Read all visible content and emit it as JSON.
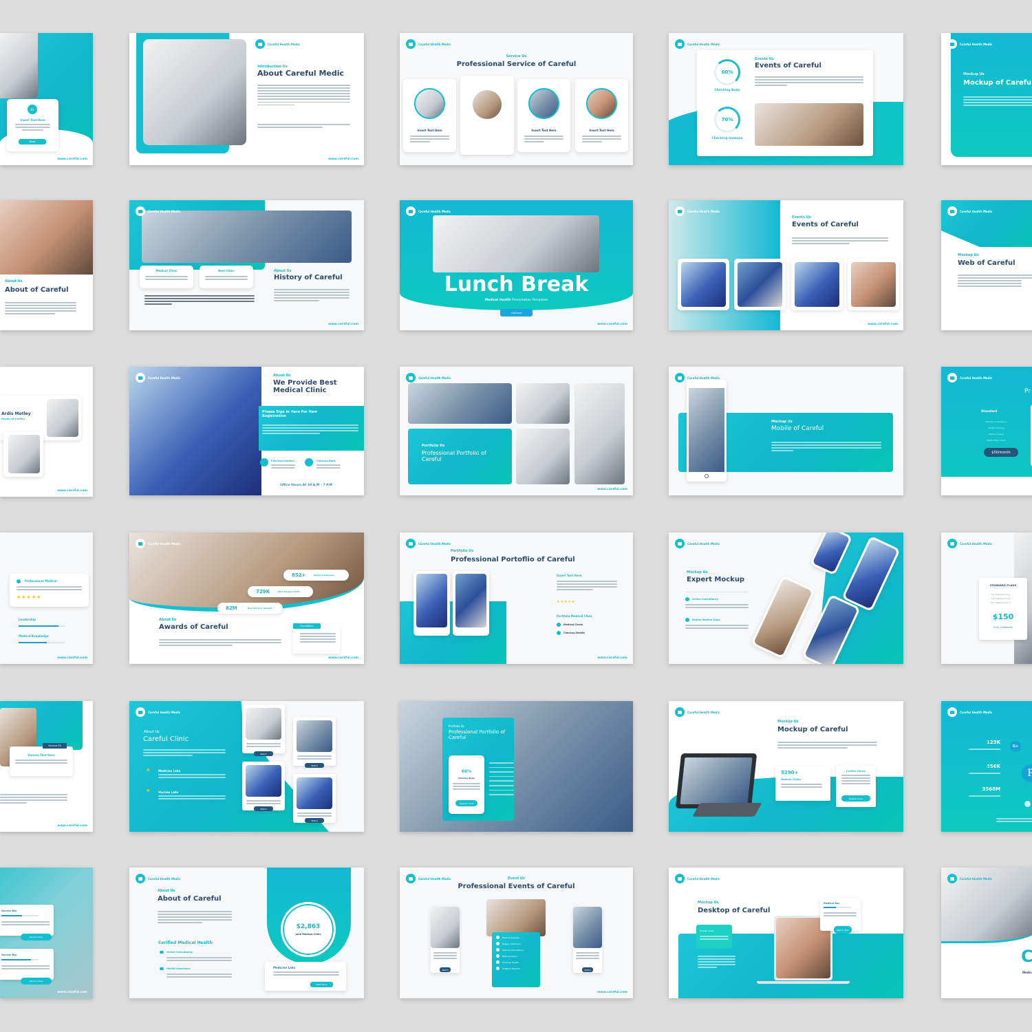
{
  "brand": {
    "logo_text": "Careful Health Medic",
    "url": "www.careful.com",
    "accent": "#14BFCF",
    "heading": "#2C4A6B",
    "background": "#DCDCDC"
  },
  "slides": {
    "r1c0": {
      "card_title": "Insert Text Here",
      "badge": "01",
      "button": "Read"
    },
    "r1c1": {
      "kicker": "Introduction Us",
      "title": "About Careful Medic"
    },
    "r1c2": {
      "kicker": "Service Us",
      "title": "Professional Service of Careful",
      "cards": [
        {
          "label": "Insert Text Here"
        },
        {
          "label": "Insert Text Here"
        },
        {
          "label": "Insert Text Here"
        },
        {
          "label": "Insert Text Here"
        }
      ]
    },
    "r1c3": {
      "kicker": "Events Us",
      "title": "Events of Careful",
      "gauges": [
        {
          "value": "60%",
          "label": "Checking Body"
        },
        {
          "value": "70%",
          "label": "Checking Immune"
        }
      ]
    },
    "r1c4": {
      "kicker": "Mockup Us",
      "title": "Mockup of Careful"
    },
    "r2c0": {
      "kicker": "About Us",
      "title": "About of Careful"
    },
    "r2c1": {
      "kicker": "About Us",
      "title": "History of Careful",
      "cards": [
        "Medical Clinic",
        "Best Clinic"
      ]
    },
    "r2c2": {
      "title": "Lunch Break",
      "subtitle_bold": "Medical Health",
      "subtitle": "Presentation Templates",
      "button": "Continue"
    },
    "r2c3": {
      "kicker": "Events Us",
      "title": "Events of Careful"
    },
    "r2c4": {
      "kicker": "Mockup Us",
      "title": "Web of Careful"
    },
    "r3c0": {
      "name": "Ardis Motley",
      "role": "Doctor at Careful"
    },
    "r3c1": {
      "kicker": "About Us",
      "title": "We Provide Best Medical Clinic",
      "panel_title": "Please Sign In Here For New Registration",
      "items": [
        "Checkup Immune",
        "Checkup Body"
      ],
      "footer": "Office Hours At 10 A.M - 7 P.M"
    },
    "r3c2": {
      "kicker": "Portfolio Us",
      "title": "Professional Portfolio of Careful"
    },
    "r3c3": {
      "kicker": "Mockup Us",
      "title": "Mobile of Careful"
    },
    "r3c4": {
      "title": "Pr",
      "plan": "Standard",
      "features": [
        "Medical Consultancy",
        "Health Checkup",
        "Medical Check",
        "Health Body Check"
      ],
      "price": "$50/month"
    },
    "r4c0": {
      "item": "Professional Medical",
      "rating": 5,
      "bars": [
        {
          "label": "Leadership",
          "value": 0.85
        },
        {
          "label": "Medical Knowledge",
          "value": 0.6
        }
      ]
    },
    "r4c1": {
      "kicker": "About Us",
      "title": "Awards of Careful",
      "stats": [
        {
          "value": "852+",
          "label": "Happy Customers"
        },
        {
          "value": "729K",
          "label": "Best Medical Clinic"
        },
        {
          "value": "82M",
          "label": "Best Doctors Awards"
        }
      ],
      "badge": "Foundation"
    },
    "r4c2": {
      "kicker": "Portfolio Us",
      "title": "Professional Portoflio of Careful",
      "side_title": "Insert Text Here",
      "rating": 5,
      "list_title": "Portfolio Medical Clinic",
      "items": [
        "Medical Check",
        "Checkup Health"
      ]
    },
    "r4c3": {
      "kicker": "Mockup Us",
      "title": "Expert Mockup",
      "items": [
        "Online Consultancy",
        "Mobile Medical Apps"
      ]
    },
    "r4c4": {
      "plan": "STANDARD PLANS",
      "features": [
        "Your features here 1",
        "Your features here 2",
        "Your features here 3"
      ],
      "price": "$150",
      "note": "50% Cashback"
    },
    "r5c0": {
      "badge": "Service 03",
      "card_title": "Service Text Here"
    },
    "r5c1": {
      "kicker": "About Us",
      "title": "Careful Clinic",
      "items": [
        "Medicine Labs",
        "Vaccine Labs"
      ],
      "button": "Watch"
    },
    "r5c2": {
      "kicker": "Portfolio Us",
      "title": "Professional Portfolio of Careful",
      "gauge_value": "66%",
      "gauge_label": "Checkup Body",
      "button": "Register Here"
    },
    "r5c3": {
      "kicker": "Mockup Us",
      "title": "Mockup of Careful",
      "stat": "5290+",
      "stat_label": "Medical Clinics",
      "card_title": "Careful Clinics",
      "button": "Register Here"
    },
    "r5c4": {
      "stats": [
        "123K",
        "356K",
        "3568M"
      ]
    },
    "r6c0": {
      "bars": [
        {
          "label": "Service Bar",
          "value": 0.55
        },
        {
          "label": "Service Bar",
          "value": 0.8
        }
      ],
      "button": "Service Here"
    },
    "r6c1": {
      "kicker": "About Us",
      "title": "About of Careful",
      "subheading": "Cerified Medical Health",
      "items": [
        "Online Consultancy",
        "Health Assurance"
      ],
      "price": "$2,863",
      "price_label": "June Medical Clinic",
      "card_title": "Medicine Labs",
      "button": "Read More"
    },
    "r6c2": {
      "kicker": "Event Us",
      "title": "Professional Events of Careful",
      "list": [
        "Medical Analysis",
        "Happy Customers",
        "Medical Consultancy",
        "Medical Check",
        "Checkup Health",
        "Software Medical"
      ],
      "button": "Watch"
    },
    "r6c3": {
      "kicker": "Mockup Us",
      "title": "Desktop of Careful",
      "bar_label": "Medical Bar",
      "bar_value": 0.45,
      "panel_title": "Update Check",
      "button": "Watch Here"
    },
    "r6c4": {
      "letter": "C",
      "sub": "Medical"
    }
  }
}
